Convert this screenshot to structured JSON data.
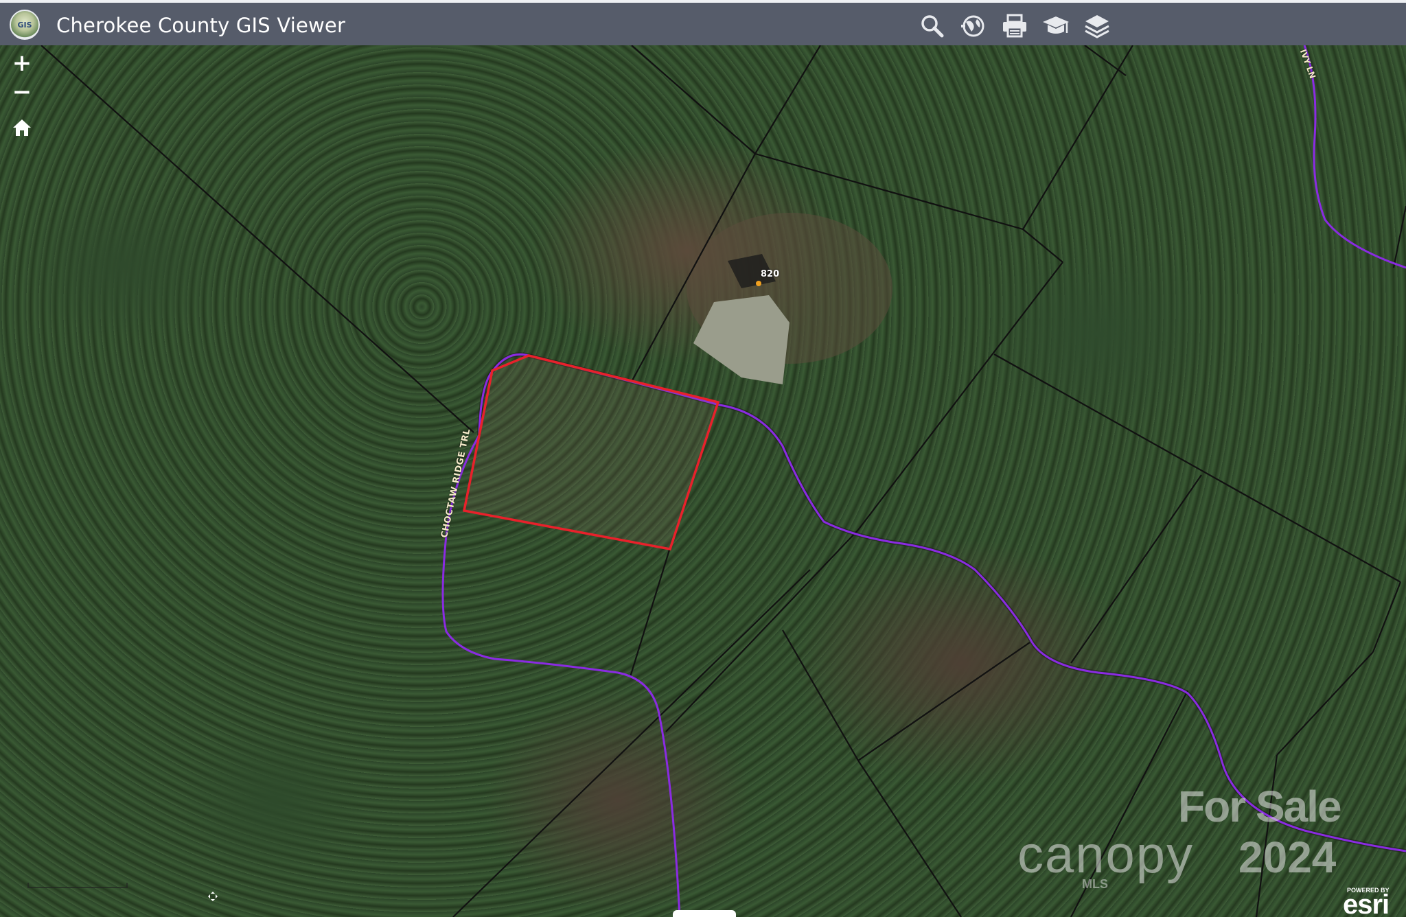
{
  "header": {
    "title": "Cherokee County GIS Viewer",
    "logo_text": "GIS",
    "tools": [
      {
        "name": "search-icon"
      },
      {
        "name": "overview-map-icon"
      },
      {
        "name": "print-icon"
      },
      {
        "name": "help-icon"
      },
      {
        "name": "layers-icon"
      }
    ]
  },
  "map": {
    "controls": {
      "zoom_in": "+",
      "zoom_out": "−",
      "home": "home-icon"
    },
    "street_label": "CHOCTAW RIDGE TRL",
    "road_label_ne": "IVY LN",
    "address_label": "820",
    "watermark": {
      "for_sale": "For Sale",
      "brand": "canopy",
      "year": "2024",
      "mls": "MLS"
    },
    "esri": {
      "powered_by": "POWERED BY",
      "logo": "esri"
    },
    "colors": {
      "parcel_highlight": "#e8212b",
      "road_line": "#8a2be2",
      "parcel_lines": "#111111"
    }
  }
}
